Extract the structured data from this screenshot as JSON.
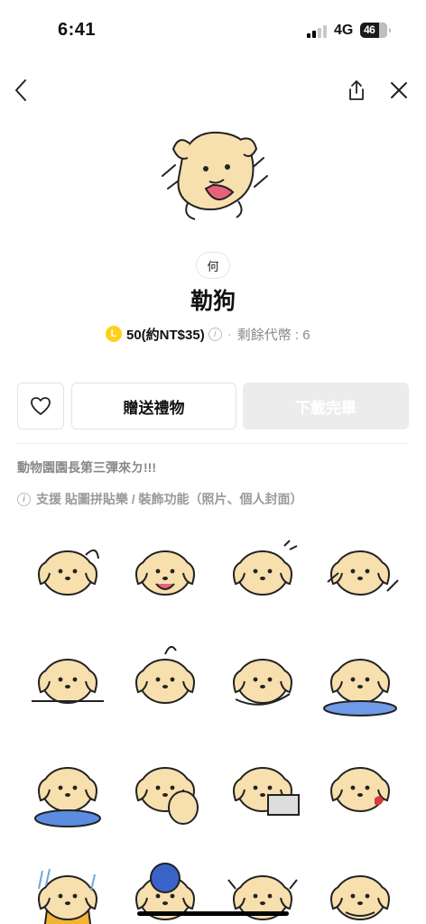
{
  "status_bar": {
    "time": "6:41",
    "network": "4G",
    "battery": "46"
  },
  "nav": {
    "back_icon": "chevron-left-icon",
    "share_icon": "share-icon",
    "close_icon": "close-icon"
  },
  "product": {
    "author_badge": "何",
    "title": "勒狗",
    "coin_symbol": "L",
    "price": "50(約NT$35)",
    "info_symbol": "i",
    "separator": "·",
    "remaining": "剩餘代幣 : 6"
  },
  "actions": {
    "favorite_icon": "heart-icon",
    "gift_label": "贈送禮物",
    "download_label": "下載完畢"
  },
  "description": "動物園園長第三彈來ㄉ!!!",
  "support_text": "支援 貼圖拼貼樂 / 裝飾功能（照片、個人封面）",
  "colors": {
    "coin": "#ffcf1a",
    "dog_fill": "#f7dfae",
    "tongue": "#e8617a",
    "disabled_button": "#ececec"
  },
  "stickers": [
    {
      "name": "sticker-dog-waving"
    },
    {
      "name": "sticker-dog-crying"
    },
    {
      "name": "sticker-dog-shy"
    },
    {
      "name": "sticker-dog-running"
    },
    {
      "name": "sticker-dog-peeking"
    },
    {
      "name": "sticker-dog-butt"
    },
    {
      "name": "sticker-dog-rolling"
    },
    {
      "name": "sticker-dog-sleeping"
    },
    {
      "name": "sticker-dog-lego-bowl"
    },
    {
      "name": "sticker-dog-paw"
    },
    {
      "name": "sticker-dog-laptop"
    },
    {
      "name": "sticker-dog-heart"
    },
    {
      "name": "sticker-dog-raincoat"
    },
    {
      "name": "sticker-dog-scooter"
    },
    {
      "name": "sticker-dog-arms-up"
    },
    {
      "name": "sticker-dog-arms-crossed"
    }
  ]
}
